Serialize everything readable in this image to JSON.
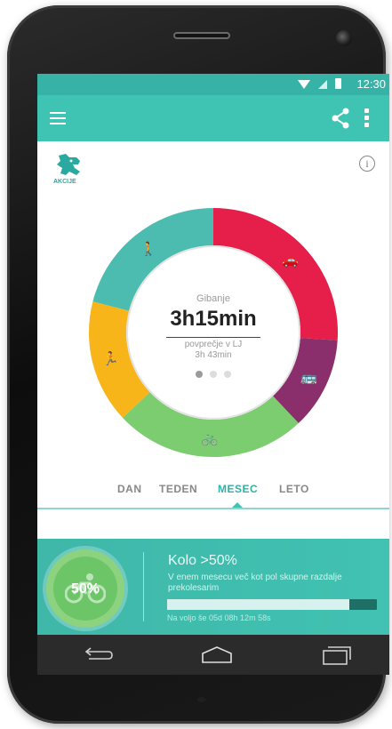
{
  "status_bar": {
    "time": "12:30"
  },
  "brand": {
    "label": "AKCIJE"
  },
  "summary": {
    "label": "Gibanje",
    "value": "3h15min",
    "average_label": "povprečje v LJ",
    "average_value": "3h 43min",
    "pager": {
      "pages": 3,
      "active": 1
    }
  },
  "ring_segments": [
    {
      "mode": "car",
      "icon": "car-icon",
      "color": "#e51e4a",
      "fraction": 0.26
    },
    {
      "mode": "bus",
      "icon": "bus-icon",
      "color": "#8a2f6b",
      "fraction": 0.12
    },
    {
      "mode": "bike",
      "icon": "bike-icon",
      "color": "#7ccd6f",
      "fraction": 0.25
    },
    {
      "mode": "run",
      "icon": "runner-icon",
      "color": "#f7b51a",
      "fraction": 0.16
    },
    {
      "mode": "walk",
      "icon": "walker-icon",
      "color": "#4bbcaf",
      "fraction": 0.21
    }
  ],
  "tabs": [
    {
      "label": "DAN",
      "active": false
    },
    {
      "label": "TEDEN",
      "active": false
    },
    {
      "label": "MESEC",
      "active": true
    },
    {
      "label": "LETO",
      "active": false
    }
  ],
  "achievement": {
    "badge": "50%",
    "title": "Kolo >50%",
    "description": "V enem mesecu več kot pol skupne razdalje prekolesarim",
    "progress": 0.87,
    "footer": "Na voljo še 05d 08h 12m 58s"
  },
  "colors": {
    "primary": "#3fc3b2",
    "status_bar": "#36b3a6",
    "nav_bar": "#2b2b2b"
  }
}
